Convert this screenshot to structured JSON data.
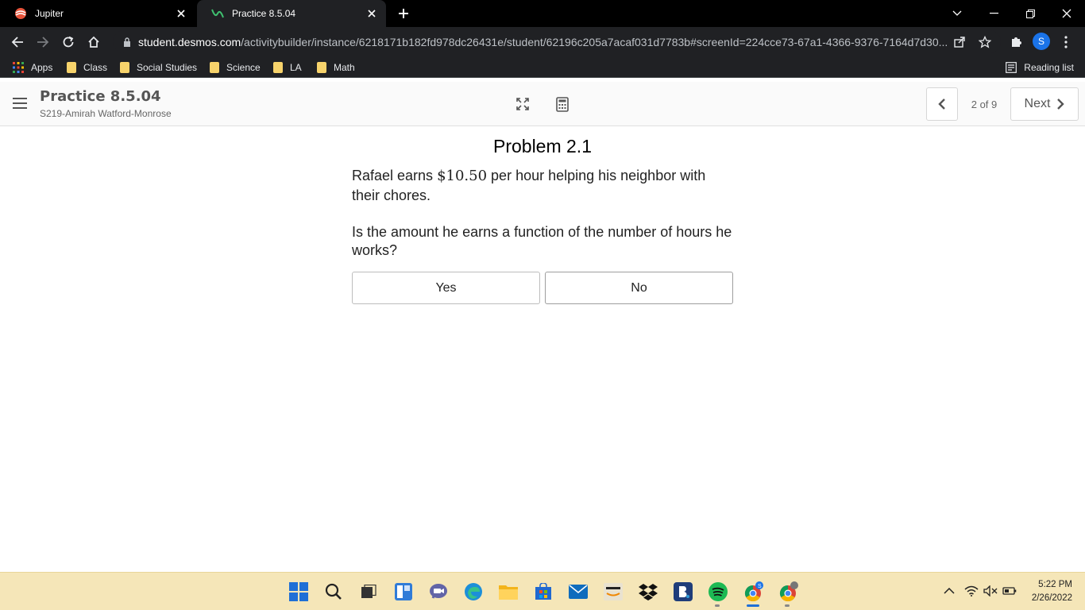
{
  "browser": {
    "tabs": [
      {
        "label": "Jupiter",
        "active": false
      },
      {
        "label": "Practice 8.5.04",
        "active": true
      }
    ],
    "url_host": "student.desmos.com",
    "url_path": "/activitybuilder/instance/6218171b182fd978dc26431e/student/62196c205a7acaf031d7783b#screenId=224cce73-67a1-4366-9376-7164d7d30...",
    "profile_initial": "S",
    "bookmarks": [
      "Apps",
      "Class",
      "Social Studies",
      "Science",
      "LA",
      "Math"
    ],
    "reading_list": "Reading list"
  },
  "header": {
    "activity_title": "Practice 8.5.04",
    "student_name": "S219-Amirah Watford-Monrose",
    "page_count": "2 of 9",
    "next_label": "Next"
  },
  "content": {
    "problem_title": "Problem 2.1",
    "para1_before": "Rafael earns ",
    "amount": "$10.50",
    "para1_after": " per hour helping his neighbor with their chores.",
    "question": "Is the amount he earns a function of the number of hours he works?",
    "choices": [
      "Yes",
      "No"
    ]
  },
  "taskbar": {
    "time": "5:22 PM",
    "date": "2/26/2022"
  },
  "colors": {
    "chrome_dark": "#202124",
    "taskbar": "#f5e6b8",
    "accent_blue": "#1a73e8"
  }
}
